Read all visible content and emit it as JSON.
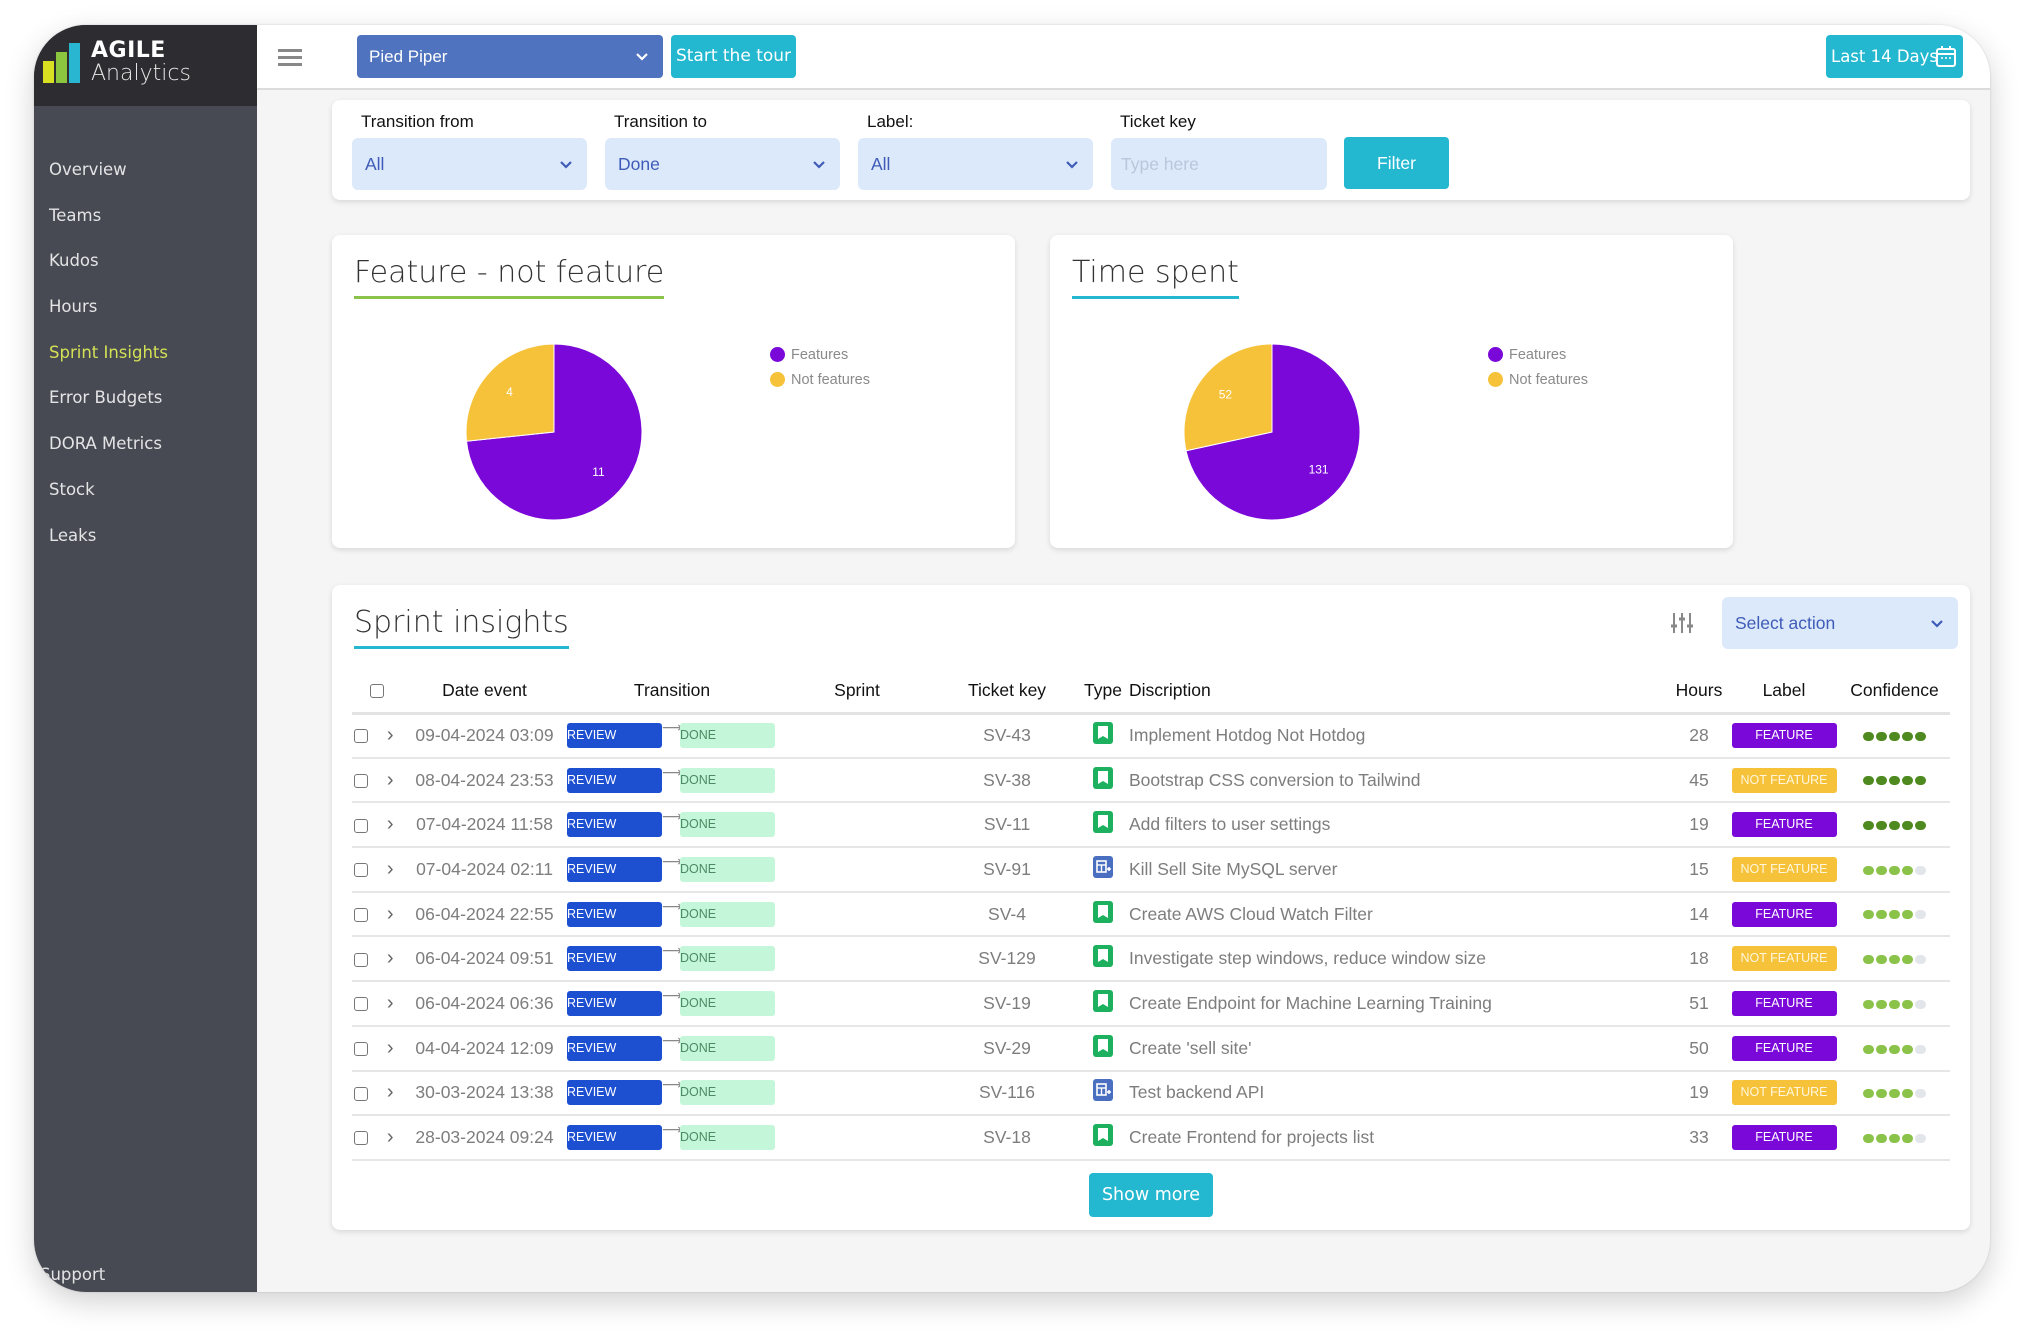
{
  "app": {
    "logo_line1": "AGILE",
    "logo_line2": "Analytics",
    "logo_bar_colors": [
      "#d9e021",
      "#8cc63f",
      "#29b6d1"
    ]
  },
  "sidebar": {
    "items": [
      {
        "label": "Overview",
        "active": false
      },
      {
        "label": "Teams",
        "active": false
      },
      {
        "label": "Kudos",
        "active": false
      },
      {
        "label": "Hours",
        "active": false
      },
      {
        "label": "Sprint Insights",
        "active": true
      },
      {
        "label": "Error Budgets",
        "active": false
      },
      {
        "label": "DORA Metrics",
        "active": false
      },
      {
        "label": "Stock",
        "active": false
      },
      {
        "label": "Leaks",
        "active": false
      }
    ],
    "support_label": "Support"
  },
  "topbar": {
    "menu_icon": "hamburger-icon",
    "organization": "Pied Piper",
    "tour_label": "Start the tour",
    "date_range_label": "Last 14 Days",
    "date_icon": "calendar-icon"
  },
  "filters": {
    "transition_from": {
      "label": "Transition from",
      "value": "All"
    },
    "transition_to": {
      "label": "Transition to",
      "value": "Done"
    },
    "label": {
      "label": "Label:",
      "value": "All"
    },
    "ticket_key": {
      "label": "Ticket key",
      "value": "",
      "placeholder": "Type here"
    },
    "filter_button": "Filter"
  },
  "colors": {
    "feature": "#7a08d9",
    "not_feature": "#f6c23a",
    "accent": "#23b8d0",
    "primary": "#4f73be",
    "sidebar_active": "#d4e157",
    "confidence_high": "#4e8a1f",
    "confidence_med": "#8bc34a",
    "confidence_empty": "#e2e5ea"
  },
  "chart_data": [
    {
      "type": "pie",
      "title": "Feature - not feature",
      "title_underline_color": "#8bc34a",
      "categories": [
        "Features",
        "Not features"
      ],
      "values": [
        11,
        4
      ],
      "colors": [
        "#7a08d9",
        "#f6c23a"
      ],
      "legend": "right"
    },
    {
      "type": "pie",
      "title": "Time spent",
      "title_underline_color": "#23b8d0",
      "categories": [
        "Features",
        "Not features"
      ],
      "values": [
        131,
        52
      ],
      "colors": [
        "#7a08d9",
        "#f6c23a"
      ],
      "legend": "right"
    }
  ],
  "insights": {
    "title": "Sprint insights",
    "action_placeholder": "Select action",
    "show_more": "Show more",
    "columns": [
      "",
      "Date event",
      "Transition",
      "Sprint",
      "Ticket key",
      "Type",
      "Discription",
      "Hours",
      "Label",
      "Confidence"
    ],
    "rows": [
      {
        "date": "09-04-2024 03:09",
        "from": "REVIEW",
        "to": "DONE",
        "sprint": "",
        "key": "SV-43",
        "type": "story",
        "description": "Implement Hotdog Not Hotdog",
        "hours": "28",
        "label": "FEATURE",
        "is_feature": true,
        "confidence": 5
      },
      {
        "date": "08-04-2024 23:53",
        "from": "REVIEW",
        "to": "DONE",
        "sprint": "",
        "key": "SV-38",
        "type": "story",
        "description": "Bootstrap CSS conversion to Tailwind",
        "hours": "45",
        "label": "NOT FEATURE",
        "is_feature": false,
        "confidence": 5
      },
      {
        "date": "07-04-2024 11:58",
        "from": "REVIEW",
        "to": "DONE",
        "sprint": "",
        "key": "SV-11",
        "type": "story",
        "description": "Add filters to user settings",
        "hours": "19",
        "label": "FEATURE",
        "is_feature": true,
        "confidence": 5
      },
      {
        "date": "07-04-2024 02:11",
        "from": "REVIEW",
        "to": "DONE",
        "sprint": "",
        "key": "SV-91",
        "type": "subtask",
        "description": "Kill Sell Site MySQL server",
        "hours": "15",
        "label": "NOT FEATURE",
        "is_feature": false,
        "confidence": 4
      },
      {
        "date": "06-04-2024 22:55",
        "from": "REVIEW",
        "to": "DONE",
        "sprint": "",
        "key": "SV-4",
        "type": "story",
        "description": "Create AWS Cloud Watch Filter",
        "hours": "14",
        "label": "FEATURE",
        "is_feature": true,
        "confidence": 4
      },
      {
        "date": "06-04-2024 09:51",
        "from": "REVIEW",
        "to": "DONE",
        "sprint": "",
        "key": "SV-129",
        "type": "story",
        "description": "Investigate step windows, reduce window size",
        "hours": "18",
        "label": "NOT FEATURE",
        "is_feature": false,
        "confidence": 4
      },
      {
        "date": "06-04-2024 06:36",
        "from": "REVIEW",
        "to": "DONE",
        "sprint": "",
        "key": "SV-19",
        "type": "story",
        "description": "Create Endpoint for Machine Learning Training",
        "hours": "51",
        "label": "FEATURE",
        "is_feature": true,
        "confidence": 4
      },
      {
        "date": "04-04-2024 12:09",
        "from": "REVIEW",
        "to": "DONE",
        "sprint": "",
        "key": "SV-29",
        "type": "story",
        "description": "Create 'sell site'",
        "hours": "50",
        "label": "FEATURE",
        "is_feature": true,
        "confidence": 4
      },
      {
        "date": "30-03-2024 13:38",
        "from": "REVIEW",
        "to": "DONE",
        "sprint": "",
        "key": "SV-116",
        "type": "subtask",
        "description": "Test backend API",
        "hours": "19",
        "label": "NOT FEATURE",
        "is_feature": false,
        "confidence": 4
      },
      {
        "date": "28-03-2024 09:24",
        "from": "REVIEW",
        "to": "DONE",
        "sprint": "",
        "key": "SV-18",
        "type": "story",
        "description": "Create Frontend for projects list",
        "hours": "33",
        "label": "FEATURE",
        "is_feature": true,
        "confidence": 4
      }
    ]
  }
}
